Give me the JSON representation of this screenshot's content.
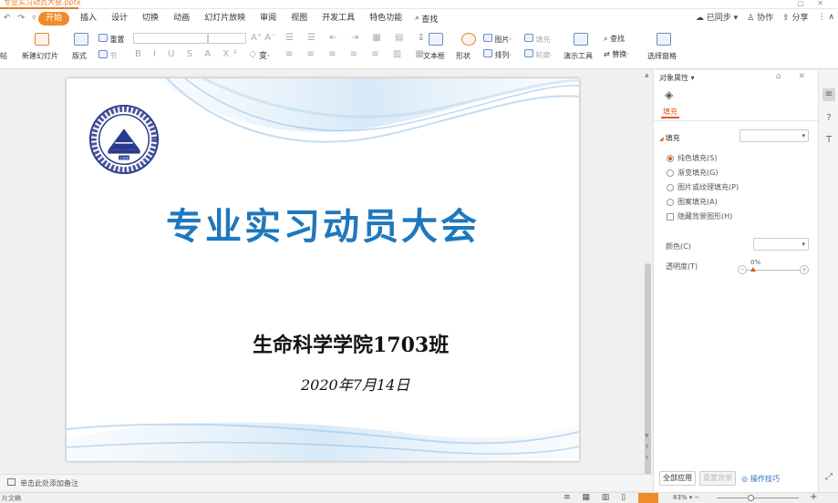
{
  "window": {
    "doc_tab": "专业实习动员大会.pptx"
  },
  "menu": {
    "tabs": [
      "开始",
      "插入",
      "设计",
      "切换",
      "动画",
      "幻灯片放映",
      "审阅",
      "视图",
      "开发工具",
      "特色功能"
    ],
    "active_tab": "开始",
    "search_label": "查找",
    "sync_label": "已同步",
    "collab_label": "协作",
    "share_label": "分享"
  },
  "ribbon": {
    "paste_partial": "帖",
    "new_slide": "新建幻灯片",
    "layout": "版式",
    "reset": "重置",
    "section": "节",
    "textbox": "文本框",
    "shape": "形状",
    "picture": "图片",
    "arrange": "排列",
    "fill": "填充",
    "outline": "轮廓",
    "present_tool": "演示工具",
    "find": "查找",
    "replace": "替换",
    "select_pane": "选择窗格"
  },
  "slide": {
    "title": "专业实习动员大会",
    "subtitle": "生命科学学院1703班",
    "date": "2020年7月14日",
    "logo_year": "1958"
  },
  "pane": {
    "header": "对象属性",
    "tab_fill": "填充",
    "section_fill": "填充",
    "options": [
      {
        "label": "纯色填充(S)",
        "selected": true
      },
      {
        "label": "渐变填充(G)",
        "selected": false
      },
      {
        "label": "图片或纹理填充(P)",
        "selected": false
      },
      {
        "label": "图案填充(A)",
        "selected": false
      }
    ],
    "hide_bg": "隐藏背景图形(H)",
    "color_label": "颜色(C)",
    "transparency_label": "透明度(T)",
    "transparency_value": "0%",
    "transparency_fraction": 0,
    "apply_all": "全部应用",
    "reset_bg": "重置背景",
    "tips": "操作技巧"
  },
  "notes": {
    "placeholder": "单击此处添加备注"
  },
  "status": {
    "left": "片文稿",
    "zoom": "83%"
  }
}
